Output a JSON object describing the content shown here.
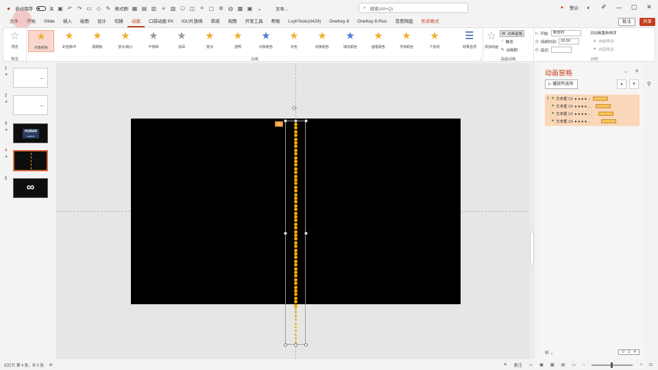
{
  "titlebar": {
    "autosave": "自动保存",
    "toggle_state": "关",
    "font_label": "宋体",
    "format_label": "格式刷",
    "text_dropdown": "文本...",
    "search_placeholder": "搜索(Alt+Q)",
    "warning_text": "警示"
  },
  "tabs": [
    "文件",
    "开始",
    "iSlide",
    "插入",
    "绘图",
    "设计",
    "切换",
    "动画",
    "口袋动画 PA",
    "iOU片放映",
    "审阅",
    "视图",
    "开发工具",
    "帮助",
    "LvyhTools(0429)",
    "OneKey 8",
    "OneKey 8 Plus",
    "百度网盘",
    "形状格式"
  ],
  "active_tab": "动画",
  "comment_label": "批注",
  "share_label": "共享",
  "ribbon": {
    "preview_label": "预览",
    "preview_group": "预览",
    "effects": [
      {
        "label": "对象颜色",
        "kind": "orange"
      },
      {
        "label": "彩色脉冲",
        "kind": "orange"
      },
      {
        "label": "跷跷板",
        "kind": "orange"
      },
      {
        "label": "放大/缩小",
        "kind": "orange"
      },
      {
        "label": "不饱和",
        "kind": "gray"
      },
      {
        "label": "加深",
        "kind": "gray"
      },
      {
        "label": "变淡",
        "kind": "orange"
      },
      {
        "label": "透明",
        "kind": "orange"
      },
      {
        "label": "对象颜色",
        "kind": "blue"
      },
      {
        "label": "补色",
        "kind": "orange"
      },
      {
        "label": "线条颜色",
        "kind": "orange"
      },
      {
        "label": "填充颜色",
        "kind": "blue"
      },
      {
        "label": "画笔颜色",
        "kind": "orange"
      },
      {
        "label": "字体颜色",
        "kind": "orange"
      },
      {
        "label": "下划线",
        "kind": "orange"
      }
    ],
    "effect_options": "效果选项",
    "animation_group": "动画",
    "add_animation": "添加动画",
    "animation_pane_btn": "动画窗格",
    "trigger": "触发",
    "animation_painter": "动画刷",
    "advanced_group": "高级动画",
    "start_label": "开始:",
    "start_value": "单击时",
    "duration_label": "持续时间:",
    "duration_value": "00.50",
    "delay_label": "延迟:",
    "delay_value": "",
    "reorder_label": "对动画重新排序",
    "move_earlier": "向前移动",
    "move_later": "向后移动",
    "timing_group": "计时"
  },
  "slides": [
    {
      "num": "1",
      "star": "★"
    },
    {
      "num": "2",
      "star": "★"
    },
    {
      "num": "3",
      "star": "★",
      "title": "HUBAR",
      "subtitle": "GROUP"
    },
    {
      "num": "4",
      "star": "★"
    },
    {
      "num": "5",
      "star": "",
      "symbol": "∞"
    }
  ],
  "anim_tag": "1",
  "pane": {
    "title": "动画窗格",
    "play_label": "播放所选项",
    "items": [
      {
        "num": "1",
        "label": "文本框 13: ● ● ● ● ..."
      },
      {
        "num": "",
        "label": "文本框 13: ● ● ● ● ..."
      },
      {
        "num": "",
        "label": "文本框 13: ● ● ● ● ..."
      },
      {
        "num": "",
        "label": "文本框 13: ● ● ● ● ..."
      }
    ],
    "seconds_label": "秒 ⌄",
    "timeline": "0  ·  2  ·  4"
  },
  "status": {
    "slide_info": "幻灯片 第 4 张，共 5 张",
    "notes_label": "备注",
    "zoom": "+"
  },
  "colors": {
    "accent": "#c43e1c",
    "dots": "#f5a800"
  }
}
